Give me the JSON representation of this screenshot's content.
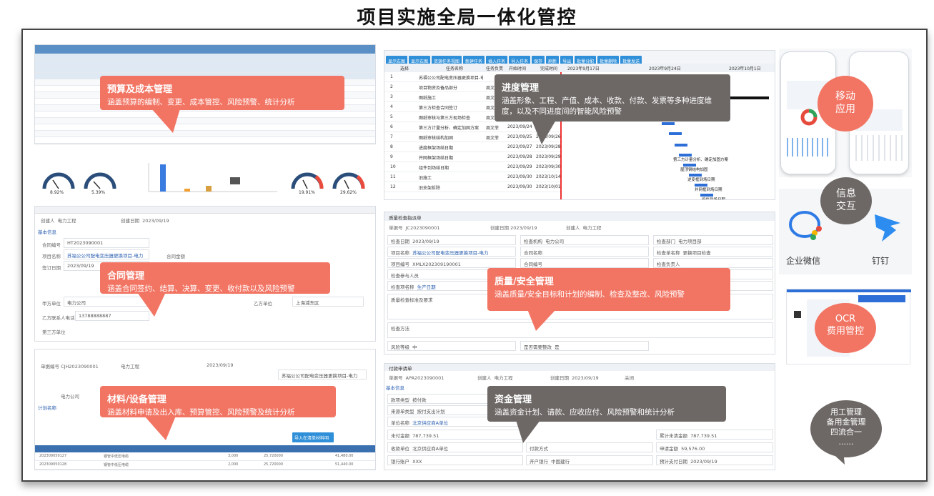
{
  "page_title": "项目实施全局一体化管控",
  "budget": {
    "title": "预算及成本管理",
    "desc": "涵盖预算的编制、变更、成本管控、风险预警、统计分析",
    "gauge_values": [
      "8.92%",
      "5.39%",
      "19.91%",
      "29.62%"
    ]
  },
  "contract": {
    "title": "合同管理",
    "desc": "涵盖合同签约、结算、决算、变更、收付款以及风险预警",
    "fields": {
      "creator_label": "创建人",
      "creator": "电力工程",
      "create_date_label": "创建日期",
      "create_date": "2023/09/19",
      "section": "基本信息",
      "contract_no_label": "合同编号",
      "contract_no": "HT2023090001",
      "project_label": "项目名称",
      "project": "苏福公公司配电变压器更换项目-电力",
      "amount_label": "合同金额",
      "sign_label": "签订日期",
      "sign_date": "2023/09/19",
      "party_label": "甲方单位",
      "party": "电力公司",
      "party_b_label": "乙方单位",
      "party_b": "上海北斗公司",
      "contact_label": "乙方联系人电话",
      "contact": "13788888887",
      "city": "上海浦东区",
      "third_label": "第三方单位"
    }
  },
  "material": {
    "title": "材料/设备管理",
    "desc": "涵盖材料申请及出入库、预算管控、风险预警及统计分析",
    "fields": {
      "code_label": "单据编号",
      "code": "CJH2023090001",
      "creator": "电力工程",
      "date": "2023/09/19",
      "project": "苏福公公司配电变压器更换项目-电力",
      "unit": "电力公司",
      "plan_label": "计划名称",
      "apply_btn": "导入在清单材料明细"
    },
    "table_rows": [
      {
        "no": "202309050127",
        "name": "钢管中低压电缆",
        "qty": "3,000",
        "price": "25,720000",
        "total": "41,480.00"
      },
      {
        "no": "202309050128",
        "name": "钢管中低压电缆",
        "qty": "2,000",
        "price": "25,720000",
        "total": "51,440.00"
      }
    ]
  },
  "progress": {
    "title": "进度管理",
    "desc": "涵盖形象、工程、产值、成本、收款、付款、发票等多种进度维度，以及不同进度间的智能风险预警",
    "toolbar": [
      "显示右图",
      "显示右图",
      "资源任务视图",
      "新建任务",
      "插入任务",
      "导入任务",
      "保存",
      "刷新",
      "导出",
      "批量分配",
      "批量删除",
      "批量发送"
    ],
    "columns": [
      "选择",
      "任务名称",
      "任务负责",
      "开始时间",
      "完成时间"
    ],
    "timeline": [
      "2023年9月17日",
      "2023年9月24日",
      "2023年10月1日"
    ],
    "weekdays": [
      "三",
      "四",
      "五"
    ],
    "rows": [
      {
        "n": "1",
        "name": "苏福公公司配电变压器更换项目-电力",
        "owner": "",
        "start": "",
        "end": ""
      },
      {
        "n": "2",
        "name": "项目物资及备品部分",
        "owner": "周文菲",
        "start": "",
        "end": ""
      },
      {
        "n": "3",
        "name": "图纸施工",
        "owner": "周文",
        "start": "",
        "end": ""
      },
      {
        "n": "4",
        "name": "第三方检查合同签订",
        "owner": "周文",
        "start": "",
        "end": ""
      },
      {
        "n": "5",
        "name": "图纸审核与第三方现场检查",
        "owner": "周文",
        "start": "",
        "end": ""
      },
      {
        "n": "6",
        "name": "第三方计量分析、确定加固方案",
        "owner": "周文菲",
        "start": "2023/09/24",
        "end": ""
      },
      {
        "n": "7",
        "name": "图纸审核结构加固",
        "owner": "周文菲",
        "start": "2023/09/25",
        "end": "2023/09/26"
      },
      {
        "n": "8",
        "name": "进度框架场结日期",
        "owner": "",
        "start": "2023/09/27",
        "end": "2023/09/28"
      },
      {
        "n": "9",
        "name": "并网框架场结日期",
        "owner": "",
        "start": "2023/09/28",
        "end": "2023/09/29"
      },
      {
        "n": "10",
        "name": "组件到场结日期",
        "owner": "",
        "start": "2023/09/29",
        "end": "2023/09/30"
      },
      {
        "n": "11",
        "name": "旧施工",
        "owner": "",
        "start": "2023/09/30",
        "end": "2023/10/14"
      },
      {
        "n": "12",
        "name": "旧支架拆除",
        "owner": "",
        "start": "2023/09/30",
        "end": "2023/10/01"
      }
    ],
    "gantt_labels": [
      "第三方计量分析、确定加固方案",
      "屋顶钢结构加固",
      "逆变框到场日期",
      "并网框到场日期",
      "组件到场日期",
      "旧支架拆除"
    ]
  },
  "quality": {
    "title": "质量/安全管理",
    "desc": "涵盖质量/安全目标和计划的编制、检查及整改、风险预警",
    "fields": {
      "tab": "质量检查指派单",
      "code_label": "单据号",
      "code": "JC2023090001",
      "date_label": "创建日期",
      "date": "2023/09/19",
      "creator_label": "创建人",
      "creator": "电力工程",
      "check_date_label": "检查日期",
      "check_date": "2023/09/19",
      "org_label": "检查机构",
      "org": "电力公司",
      "dept_label": "检查部门",
      "dept": "电力项目部",
      "project_label": "项目名称",
      "project": "苏福公公司配电变压器更换项目-电力",
      "contract_label": "合同名称",
      "check_name_label": "检查单名称",
      "check_name": "更换项目检查",
      "project_no_label": "项目编号",
      "project_no": "XMLX202309190001",
      "contract_no_label": "合同编号",
      "owner_label": "检查负责人",
      "member_label": "检查参与人员",
      "item_label": "检查项名称",
      "item": "生产日期",
      "std_label": "质量检查标准及要求",
      "method_label": "检查方法",
      "risk_label": "风险等级",
      "risk": "中",
      "rectify_label": "是否需要整改",
      "rectify": "是"
    }
  },
  "fund": {
    "title": "资金管理",
    "desc": "涵盖资金计划、请款、应收应付、风险预警和统计分析",
    "fields": {
      "tab": "付款申请单",
      "code_label": "单据号",
      "code": "APA2023090001",
      "creator_label": "创建人",
      "creator": "电力工程",
      "date_label": "创建日期",
      "date": "2023/09/19",
      "close_label": "关闭",
      "section": "基本信息",
      "type_label": "款项类型",
      "type": "按付款",
      "src_label": "来源单类型",
      "src": "按付支出计划",
      "unit_label": "单位名称",
      "unit": "北京供应商A单位",
      "unpaid_label": "未付金额",
      "unpaid": "787,739.51",
      "paid_label": "累计未清金额",
      "paid": "787,739.51",
      "payee_label": "收款单位",
      "payee": "北京供应商A单位",
      "method_label": "付款方式",
      "apply_label": "申请金额",
      "apply": "59,576.00",
      "bank_user_label": "银行账户",
      "bank_user": "XXX",
      "bank_label": "开户银行",
      "bank": "中国建行",
      "pay_date_label": "预计支付日期",
      "pay_date": "2023/09/19"
    }
  },
  "mobile": {
    "label": "移动\n应用"
  },
  "im": {
    "label": "信息\n交互",
    "wechat": "企业微信",
    "dingtalk": "钉钉"
  },
  "ocr": {
    "label": "OCR\n费用管控"
  },
  "expense": {
    "label": "用工管理\n备用金管理\n四流合一\n......"
  }
}
